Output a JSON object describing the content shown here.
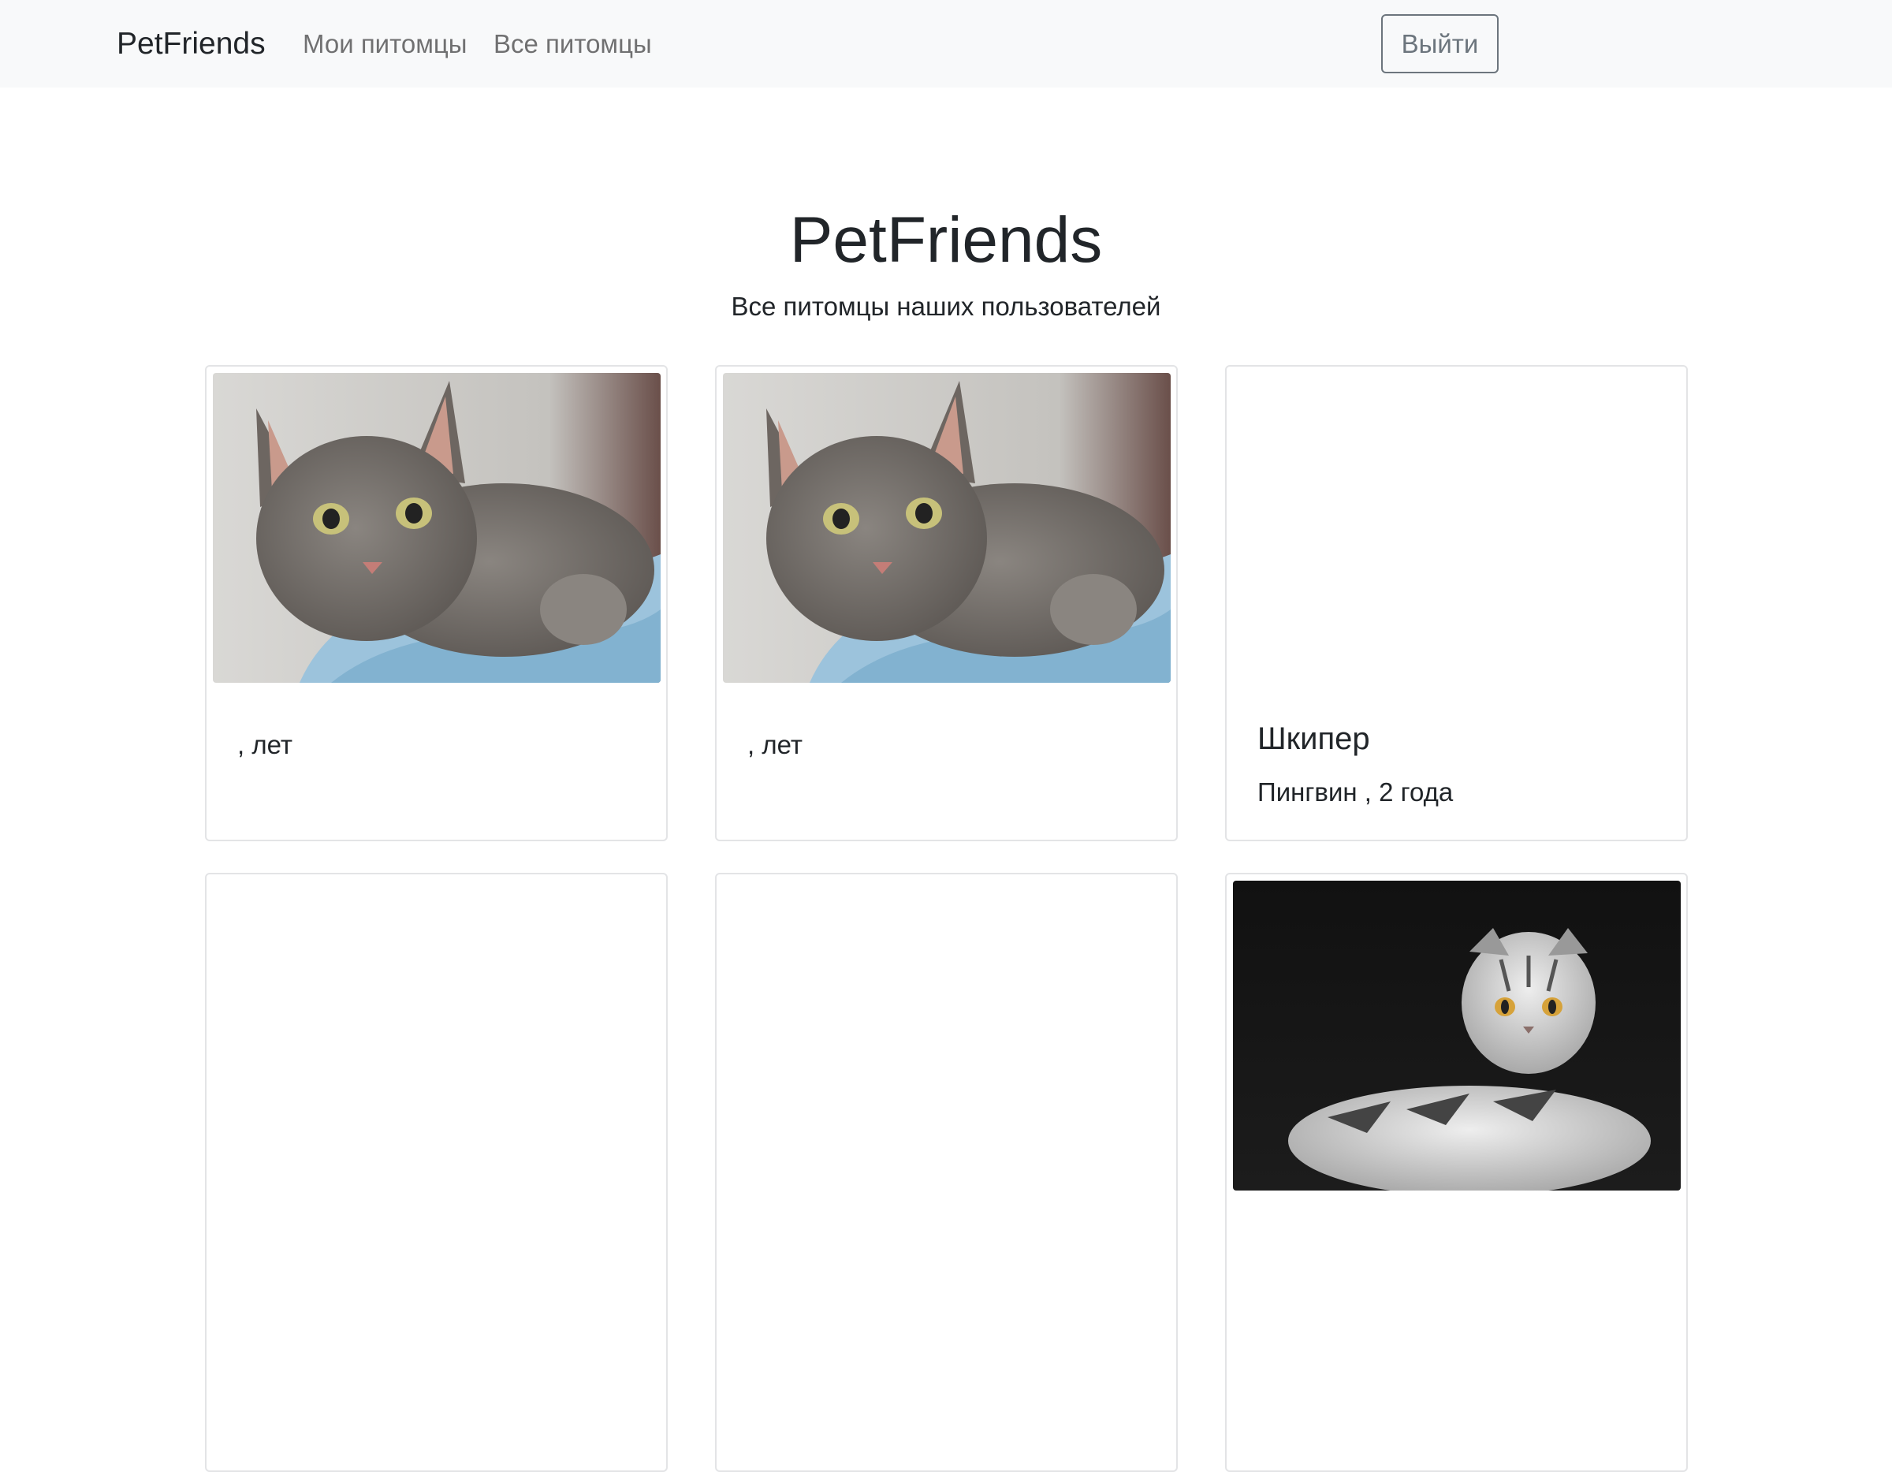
{
  "navbar": {
    "brand": "PetFriends",
    "links": [
      {
        "label": "Мои питомцы"
      },
      {
        "label": "Все питомцы"
      }
    ],
    "logout_label": "Выйти"
  },
  "header": {
    "title": "PetFriends",
    "subtitle": "Все питомцы наших пользователей"
  },
  "pets": [
    {
      "name": "",
      "details": ", лет",
      "image": "gray-tabby-cat-photo"
    },
    {
      "name": "",
      "details": ", лет",
      "image": "gray-tabby-cat-photo"
    },
    {
      "name": "Шкипер",
      "details": "Пингвин , 2 года",
      "image": ""
    },
    {
      "name": "",
      "details": "",
      "image": ""
    },
    {
      "name": "",
      "details": "",
      "image": ""
    },
    {
      "name": "",
      "details": "",
      "image": "scottish-fold-cat-photo"
    }
  ],
  "colors": {
    "navbar_bg": "#f8f9fa",
    "link_muted": "#7a7d80",
    "button_border": "#6c757d",
    "card_border": "#e3e4e6",
    "text": "#212529"
  }
}
